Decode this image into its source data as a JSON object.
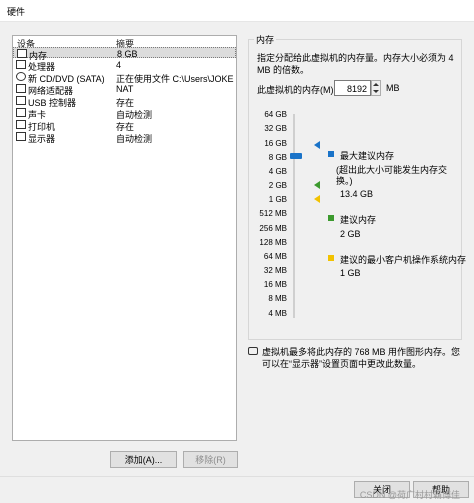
{
  "window": {
    "title": "硬件"
  },
  "device_list": {
    "headers": {
      "device": "设备",
      "summary": "摘要"
    },
    "items": [
      {
        "icon": "memory-icon",
        "name": "内存",
        "value": "8 GB"
      },
      {
        "icon": "cpu-icon",
        "name": "处理器",
        "value": "4"
      },
      {
        "icon": "cd-drive-icon",
        "name": "新 CD/DVD (SATA)",
        "value": "正在使用文件 C:\\Users\\JOKER..."
      },
      {
        "icon": "network-adapter-icon",
        "name": "网络适配器",
        "value": "NAT"
      },
      {
        "icon": "usb-icon",
        "name": "USB 控制器",
        "value": "存在"
      },
      {
        "icon": "sound-card-icon",
        "name": "声卡",
        "value": "自动检测"
      },
      {
        "icon": "printer-icon",
        "name": "打印机",
        "value": "存在"
      },
      {
        "icon": "display-icon",
        "name": "显示器",
        "value": "自动检测"
      }
    ]
  },
  "buttons": {
    "add": "添加(A)...",
    "remove": "移除(R)",
    "close": "关闭",
    "help": "帮助"
  },
  "memory": {
    "group_title": "内存",
    "description": "指定分配给此虚拟机的内存量。内存大小必须为 4 MB 的倍数。",
    "field_label": "此虚拟机的内存(M):",
    "value": "8192",
    "unit": "MB",
    "ticks": [
      "64 GB",
      "32 GB",
      "16 GB",
      "8 GB",
      "4 GB",
      "2 GB",
      "1 GB",
      "512 MB",
      "256 MB",
      "128 MB",
      "64 MB",
      "32 MB",
      "16 MB",
      "8 MB",
      "4 MB"
    ],
    "legend": {
      "max_recommended": {
        "label": "最大建议内存",
        "note": "(超出此大小可能发生内存交换。)",
        "value": "13.4 GB",
        "color": "#1a73c8"
      },
      "recommended": {
        "label": "建议内存",
        "value": "2 GB",
        "color": "#3c9a2e"
      },
      "min_recommended": {
        "label": "建议的最小客户机操作系统内存",
        "value": "1 GB",
        "color": "#f2c200"
      }
    }
  },
  "note": "虚拟机最多将此内存的 768 MB 用作图形内存。您可以在“显示器”设置页面中更改此数量。",
  "watermark": "CSDN @荷广村村霸博佳"
}
